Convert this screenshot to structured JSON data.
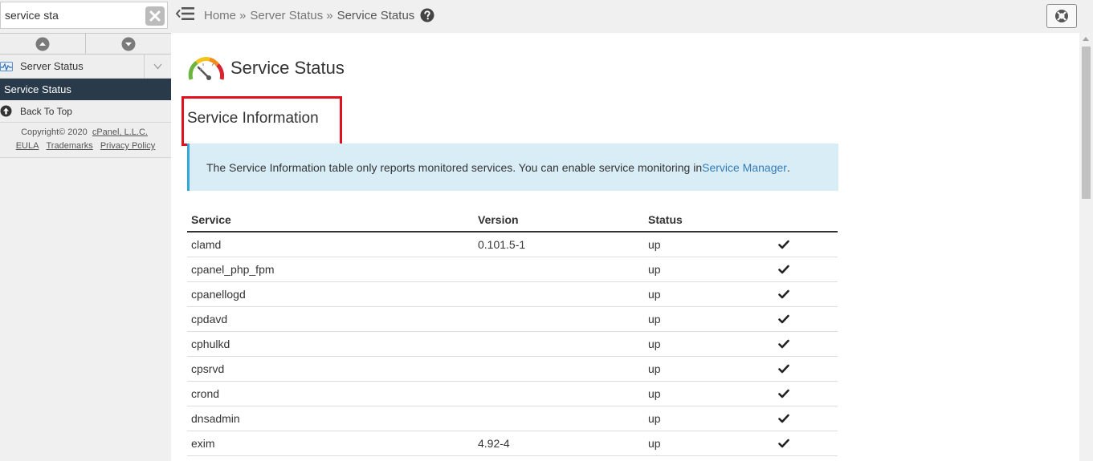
{
  "sidebar": {
    "search_value": "service sta",
    "group_label": "Server Status",
    "active_item": "Service Status",
    "back_to_top": "Back To Top",
    "copyright": "Copyright© 2020",
    "company_link": "cPanel, L.L.C.",
    "links": [
      "EULA",
      "Trademarks",
      "Privacy Policy"
    ]
  },
  "breadcrumb": {
    "home": "Home",
    "sep1": "»",
    "section": "Server Status",
    "sep2": "»",
    "current": "Service Status"
  },
  "page": {
    "title": "Service Status",
    "section_title": "Service Information",
    "alert_text": "The Service Information table only reports monitored services. You can enable service monitoring in ",
    "alert_link": "Service Manager",
    "alert_end": "."
  },
  "table": {
    "headers": [
      "Service",
      "Version",
      "Status",
      ""
    ],
    "rows": [
      {
        "service": "clamd",
        "version": "0.101.5-1",
        "status": "up"
      },
      {
        "service": "cpanel_php_fpm",
        "version": "",
        "status": "up"
      },
      {
        "service": "cpanellogd",
        "version": "",
        "status": "up"
      },
      {
        "service": "cpdavd",
        "version": "",
        "status": "up"
      },
      {
        "service": "cphulkd",
        "version": "",
        "status": "up"
      },
      {
        "service": "cpsrvd",
        "version": "",
        "status": "up"
      },
      {
        "service": "crond",
        "version": "",
        "status": "up"
      },
      {
        "service": "dnsadmin",
        "version": "",
        "status": "up"
      },
      {
        "service": "exim",
        "version": "4.92-4",
        "status": "up"
      }
    ]
  },
  "colors": {
    "sidebar_active_bg": "#293a4a",
    "alert_bg": "#d9edf7",
    "alert_border": "#31a6d8",
    "link": "#337ab7",
    "highlight": "#e0101e"
  }
}
